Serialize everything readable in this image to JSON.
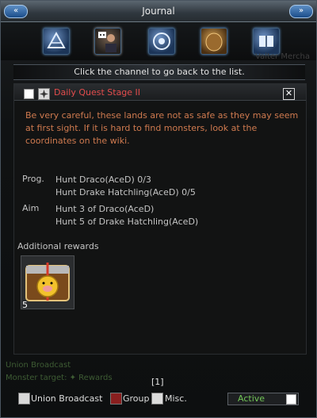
{
  "window": {
    "title": "Journal",
    "left_button": "«",
    "right_button": "»"
  },
  "tabs": [
    {
      "name": "quest-map-icon"
    },
    {
      "name": "npc-portrait-icon"
    },
    {
      "name": "emblem-icon"
    },
    {
      "name": "stone-icon"
    },
    {
      "name": "book-icon"
    }
  ],
  "background_text": {
    "top_right": "Valter Mercha",
    "chat_lines": [
      "Union Broadcast",
      "Monster target: ✦ Rewards"
    ]
  },
  "channel_bar": {
    "text": "Click the channel to go back to the list."
  },
  "quest": {
    "title": "Daily Quest Stage II",
    "description": "Be very careful, these lands are not as safe as they may seem at first sight. If it is hard to find monsters, look at the coordinates on the wiki.",
    "progress_label": "Prog.",
    "progress": [
      "Hunt Draco(AceD)    0/3",
      "Hunt Drake Hatchling(AceD)    0/5"
    ],
    "aim_label": "Aim",
    "aim": [
      "Hunt 3 of Draco(AceD)",
      "Hunt 5 of Drake Hatchling(AceD)"
    ],
    "rewards_title": "Additional rewards",
    "reward": {
      "icon": "pig-treasure-chest-icon",
      "count": "5"
    }
  },
  "page_number": "[1]",
  "bottom_bar": {
    "union_label": "Union Broadcast",
    "group_label": "Group",
    "misc_label": "Misc.",
    "status": "Active",
    "colors": {
      "active": "#72c657",
      "title_red": "#e24c4c",
      "desc_orange": "#cf7a4f"
    }
  }
}
